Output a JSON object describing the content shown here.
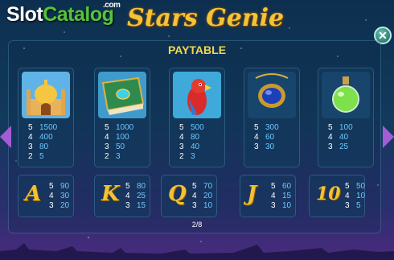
{
  "branding": {
    "slot": "Slot",
    "catalog": "Catalog",
    "com": ".com"
  },
  "game_title": "Stars Genie",
  "paytable_title": "PAYTABLE",
  "page_indicator": "2/8",
  "close_icon": "close-x-icon",
  "colors": {
    "title_gold": "#f2d94a",
    "payout_blue": "#6cc7ff",
    "arrow_purple": "#a35cd6",
    "logo_green": "#55c43a"
  },
  "high_symbols": [
    {
      "name": "palace",
      "pays": [
        {
          "count": "5",
          "amount": "1500"
        },
        {
          "count": "4",
          "amount": "400"
        },
        {
          "count": "3",
          "amount": "80"
        },
        {
          "count": "2",
          "amount": "5"
        }
      ]
    },
    {
      "name": "book",
      "pays": [
        {
          "count": "5",
          "amount": "1000"
        },
        {
          "count": "4",
          "amount": "100"
        },
        {
          "count": "3",
          "amount": "50"
        },
        {
          "count": "2",
          "amount": "3"
        }
      ]
    },
    {
      "name": "parrot",
      "pays": [
        {
          "count": "5",
          "amount": "500"
        },
        {
          "count": "4",
          "amount": "80"
        },
        {
          "count": "3",
          "amount": "40"
        },
        {
          "count": "2",
          "amount": "3"
        }
      ]
    },
    {
      "name": "amulet",
      "pays": [
        {
          "count": "5",
          "amount": "300"
        },
        {
          "count": "4",
          "amount": "60"
        },
        {
          "count": "3",
          "amount": "30"
        }
      ]
    },
    {
      "name": "potion",
      "pays": [
        {
          "count": "5",
          "amount": "100"
        },
        {
          "count": "4",
          "amount": "40"
        },
        {
          "count": "3",
          "amount": "25"
        }
      ]
    }
  ],
  "low_symbols": [
    {
      "letter": "A",
      "pays": [
        {
          "count": "5",
          "amount": "90"
        },
        {
          "count": "4",
          "amount": "30"
        },
        {
          "count": "3",
          "amount": "20"
        }
      ]
    },
    {
      "letter": "K",
      "pays": [
        {
          "count": "5",
          "amount": "80"
        },
        {
          "count": "4",
          "amount": "25"
        },
        {
          "count": "3",
          "amount": "15"
        }
      ]
    },
    {
      "letter": "Q",
      "pays": [
        {
          "count": "5",
          "amount": "70"
        },
        {
          "count": "4",
          "amount": "20"
        },
        {
          "count": "3",
          "amount": "10"
        }
      ]
    },
    {
      "letter": "J",
      "pays": [
        {
          "count": "5",
          "amount": "60"
        },
        {
          "count": "4",
          "amount": "15"
        },
        {
          "count": "3",
          "amount": "10"
        }
      ]
    },
    {
      "letter": "10",
      "pays": [
        {
          "count": "5",
          "amount": "50"
        },
        {
          "count": "4",
          "amount": "10"
        },
        {
          "count": "3",
          "amount": "5"
        }
      ]
    }
  ]
}
